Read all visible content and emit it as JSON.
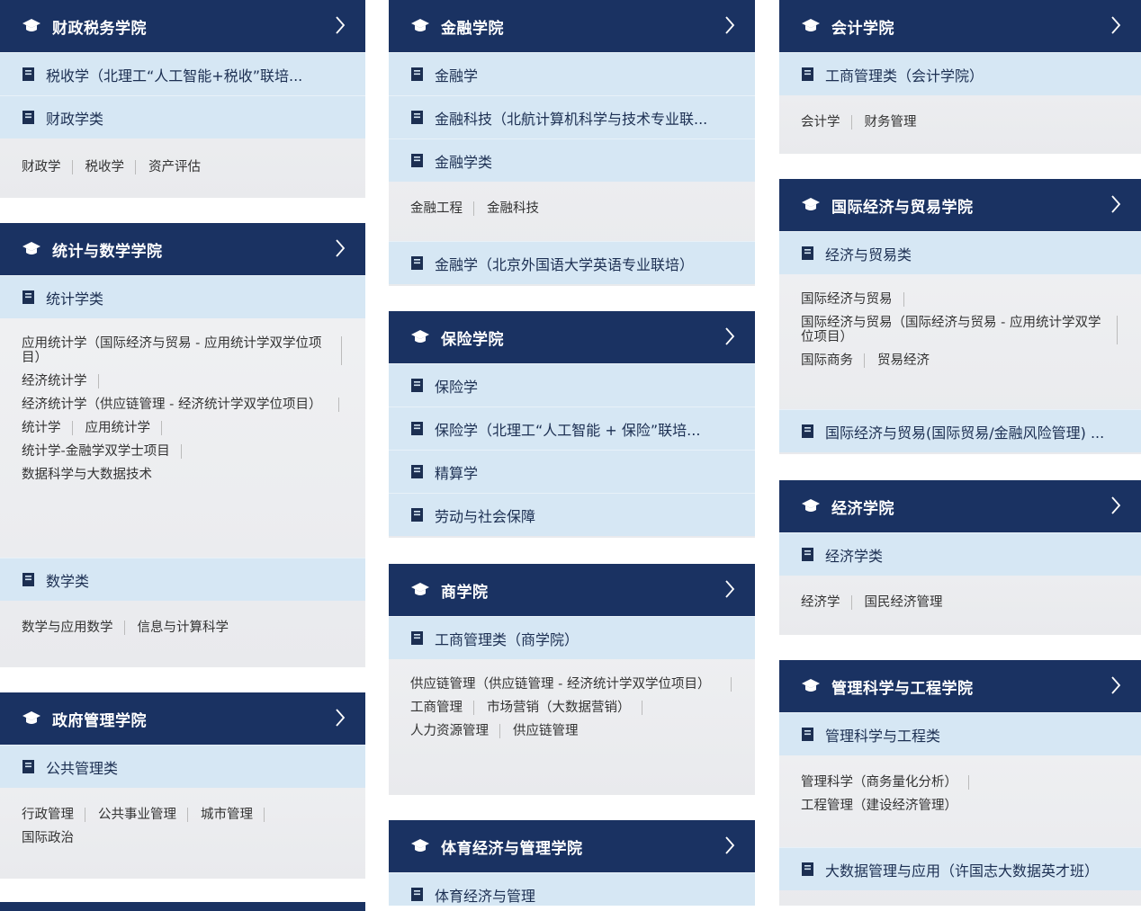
{
  "columns": [
    {
      "cards": [
        {
          "title": "财政税务学院",
          "majors": [
            "税收学（北理工“人工智能+税收”联培...",
            "财政学类"
          ],
          "subs": [
            [
              "财政学",
              "税收学",
              "资产评估"
            ]
          ]
        },
        {
          "title": "统计与数学学院",
          "majors": [
            "统计学类"
          ],
          "subs": [
            [
              "应用统计学（国际经济与贸易 - 应用统计学双学位项目）"
            ],
            [
              "经济统计学"
            ],
            [
              "经济统计学（供应链管理 - 经济统计学双学位项目）"
            ],
            [
              "统计学",
              "应用统计学"
            ],
            [
              "统计学-金融学双学士项目"
            ],
            [
              "数据科学与大数据技术"
            ]
          ],
          "majors2": [
            "数学类"
          ],
          "subs2": [
            [
              "数学与应用数学",
              "信息与计算科学"
            ]
          ]
        },
        {
          "title": "政府管理学院",
          "majors": [
            "公共管理类"
          ],
          "subs": [
            [
              "行政管理",
              "公共事业管理",
              "城市管理"
            ],
            [
              "国际政治"
            ]
          ]
        }
      ]
    },
    {
      "cards": [
        {
          "title": "金融学院",
          "majors": [
            "金融学",
            "金融科技（北航计算机科学与技术专业联...",
            "金融学类"
          ],
          "subs": [
            [
              "金融工程",
              "金融科技"
            ]
          ],
          "majors2": [
            "金融学（北京外国语大学英语专业联培）"
          ]
        },
        {
          "title": "保险学院",
          "majors": [
            "保险学",
            "保险学（北理工“人工智能 + 保险”联培...",
            "精算学",
            "劳动与社会保障"
          ]
        },
        {
          "title": "商学院",
          "majors": [
            "工商管理类（商学院）"
          ],
          "subs": [
            [
              "供应链管理（供应链管理 - 经济统计学双学位项目）"
            ],
            [
              "工商管理",
              "市场营销（大数据营销）"
            ],
            [
              "人力资源管理",
              "供应链管理"
            ]
          ]
        },
        {
          "title": "体育经济与管理学院",
          "majors": [
            "体育经济与管理"
          ]
        }
      ]
    },
    {
      "cards": [
        {
          "title": "会计学院",
          "majors": [
            "工商管理类（会计学院）"
          ],
          "subs": [
            [
              "会计学",
              "财务管理"
            ]
          ]
        },
        {
          "title": "国际经济与贸易学院",
          "majors": [
            "经济与贸易类"
          ],
          "subs": [
            [
              "国际经济与贸易"
            ],
            [
              "国际经济与贸易（国际经济与贸易 - 应用统计学双学位项目）"
            ],
            [
              "国际商务",
              "贸易经济"
            ]
          ],
          "majors2": [
            "国际经济与贸易(国际贸易/金融风险管理) ..."
          ]
        },
        {
          "title": "经济学院",
          "majors": [
            "经济学类"
          ],
          "subs": [
            [
              "经济学",
              "国民经济管理"
            ]
          ]
        },
        {
          "title": "管理科学与工程学院",
          "majors": [
            "管理科学与工程类"
          ],
          "subs": [
            [
              "管理科学（商务量化分析）"
            ],
            [
              "工程管理（建设经济管理）"
            ]
          ],
          "majors2": [
            "大数据管理与应用（许国志大数据英才班）"
          ]
        }
      ]
    }
  ],
  "icons": {
    "header": "graduation-cap-icon",
    "major": "book-icon",
    "expand": "chevron-right-icon"
  },
  "colors": {
    "header_bg": "#1a3262",
    "major_bg": "#d6e7f4",
    "card_bg": "#eceef1"
  }
}
